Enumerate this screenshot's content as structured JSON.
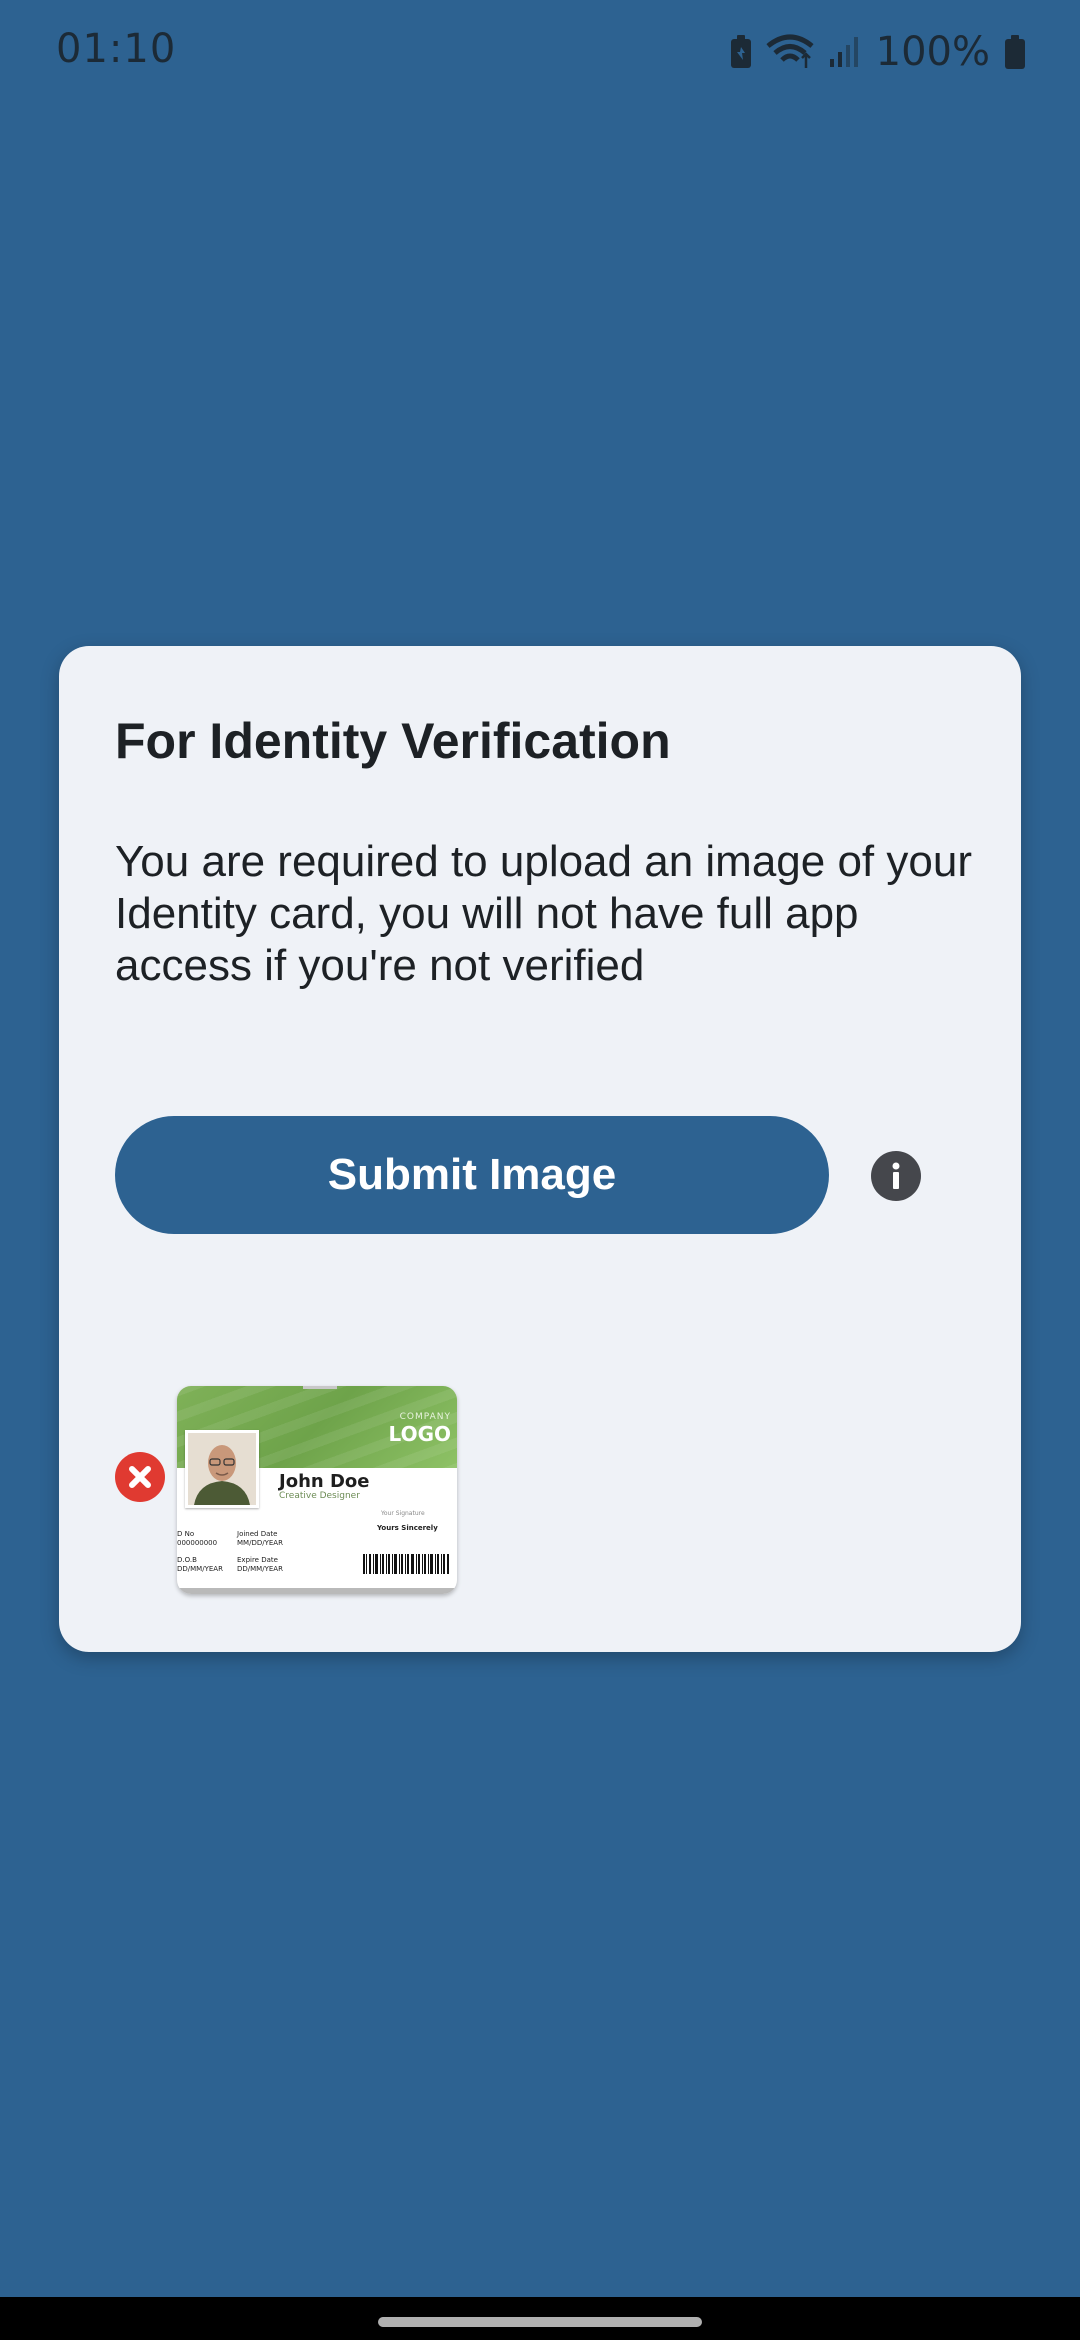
{
  "status_bar": {
    "time": "01:10",
    "battery_percent": "100%",
    "icons": [
      "battery-saver-icon",
      "wifi-icon",
      "signal-icon",
      "battery-icon"
    ]
  },
  "dialog": {
    "title": "For Identity Verification",
    "message": "You are required to upload an image of your Identity card, you will not have full app access if you're not verified",
    "submit_label": "Submit Image",
    "info_icon": "info-icon",
    "remove_icon": "remove-image-icon"
  },
  "uploaded_image": {
    "logo_small": "COMPANY",
    "logo": "LOGO",
    "name": "John Doe",
    "role": "Creative Designer",
    "id_label": "D No",
    "id_value": "000000000",
    "joined_label": "Joined Date",
    "joined_value": "MM/DD/YEAR",
    "dob_label": "D.O.B",
    "dob_value": "DD/MM/YEAR",
    "expire_label": "Expire Date",
    "expire_value": "DD/MM/YEAR",
    "signature_label": "Your Signature",
    "signature": "Yours Sincerely"
  },
  "colors": {
    "background": "#2d6291",
    "dialog": "#eff2f7",
    "primary": "#2d6291",
    "remove": "#e03a31",
    "info": "#45474c"
  }
}
